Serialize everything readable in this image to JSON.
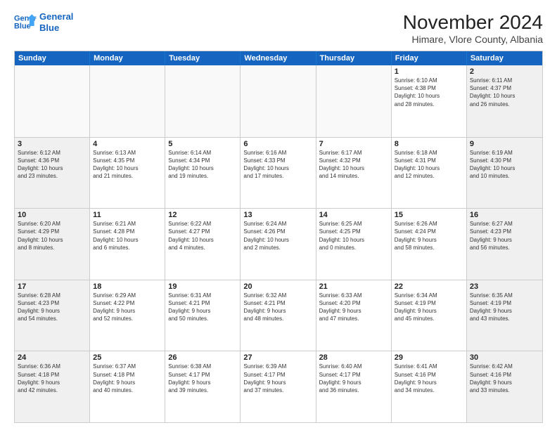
{
  "logo": {
    "line1": "General",
    "line2": "Blue"
  },
  "title": "November 2024",
  "location": "Himare, Vlore County, Albania",
  "header_days": [
    "Sunday",
    "Monday",
    "Tuesday",
    "Wednesday",
    "Thursday",
    "Friday",
    "Saturday"
  ],
  "weeks": [
    [
      {
        "day": "",
        "info": ""
      },
      {
        "day": "",
        "info": ""
      },
      {
        "day": "",
        "info": ""
      },
      {
        "day": "",
        "info": ""
      },
      {
        "day": "",
        "info": ""
      },
      {
        "day": "1",
        "info": "Sunrise: 6:10 AM\nSunset: 4:38 PM\nDaylight: 10 hours\nand 28 minutes."
      },
      {
        "day": "2",
        "info": "Sunrise: 6:11 AM\nSunset: 4:37 PM\nDaylight: 10 hours\nand 26 minutes."
      }
    ],
    [
      {
        "day": "3",
        "info": "Sunrise: 6:12 AM\nSunset: 4:36 PM\nDaylight: 10 hours\nand 23 minutes."
      },
      {
        "day": "4",
        "info": "Sunrise: 6:13 AM\nSunset: 4:35 PM\nDaylight: 10 hours\nand 21 minutes."
      },
      {
        "day": "5",
        "info": "Sunrise: 6:14 AM\nSunset: 4:34 PM\nDaylight: 10 hours\nand 19 minutes."
      },
      {
        "day": "6",
        "info": "Sunrise: 6:16 AM\nSunset: 4:33 PM\nDaylight: 10 hours\nand 17 minutes."
      },
      {
        "day": "7",
        "info": "Sunrise: 6:17 AM\nSunset: 4:32 PM\nDaylight: 10 hours\nand 14 minutes."
      },
      {
        "day": "8",
        "info": "Sunrise: 6:18 AM\nSunset: 4:31 PM\nDaylight: 10 hours\nand 12 minutes."
      },
      {
        "day": "9",
        "info": "Sunrise: 6:19 AM\nSunset: 4:30 PM\nDaylight: 10 hours\nand 10 minutes."
      }
    ],
    [
      {
        "day": "10",
        "info": "Sunrise: 6:20 AM\nSunset: 4:29 PM\nDaylight: 10 hours\nand 8 minutes."
      },
      {
        "day": "11",
        "info": "Sunrise: 6:21 AM\nSunset: 4:28 PM\nDaylight: 10 hours\nand 6 minutes."
      },
      {
        "day": "12",
        "info": "Sunrise: 6:22 AM\nSunset: 4:27 PM\nDaylight: 10 hours\nand 4 minutes."
      },
      {
        "day": "13",
        "info": "Sunrise: 6:24 AM\nSunset: 4:26 PM\nDaylight: 10 hours\nand 2 minutes."
      },
      {
        "day": "14",
        "info": "Sunrise: 6:25 AM\nSunset: 4:25 PM\nDaylight: 10 hours\nand 0 minutes."
      },
      {
        "day": "15",
        "info": "Sunrise: 6:26 AM\nSunset: 4:24 PM\nDaylight: 9 hours\nand 58 minutes."
      },
      {
        "day": "16",
        "info": "Sunrise: 6:27 AM\nSunset: 4:23 PM\nDaylight: 9 hours\nand 56 minutes."
      }
    ],
    [
      {
        "day": "17",
        "info": "Sunrise: 6:28 AM\nSunset: 4:23 PM\nDaylight: 9 hours\nand 54 minutes."
      },
      {
        "day": "18",
        "info": "Sunrise: 6:29 AM\nSunset: 4:22 PM\nDaylight: 9 hours\nand 52 minutes."
      },
      {
        "day": "19",
        "info": "Sunrise: 6:31 AM\nSunset: 4:21 PM\nDaylight: 9 hours\nand 50 minutes."
      },
      {
        "day": "20",
        "info": "Sunrise: 6:32 AM\nSunset: 4:21 PM\nDaylight: 9 hours\nand 48 minutes."
      },
      {
        "day": "21",
        "info": "Sunrise: 6:33 AM\nSunset: 4:20 PM\nDaylight: 9 hours\nand 47 minutes."
      },
      {
        "day": "22",
        "info": "Sunrise: 6:34 AM\nSunset: 4:19 PM\nDaylight: 9 hours\nand 45 minutes."
      },
      {
        "day": "23",
        "info": "Sunrise: 6:35 AM\nSunset: 4:19 PM\nDaylight: 9 hours\nand 43 minutes."
      }
    ],
    [
      {
        "day": "24",
        "info": "Sunrise: 6:36 AM\nSunset: 4:18 PM\nDaylight: 9 hours\nand 42 minutes."
      },
      {
        "day": "25",
        "info": "Sunrise: 6:37 AM\nSunset: 4:18 PM\nDaylight: 9 hours\nand 40 minutes."
      },
      {
        "day": "26",
        "info": "Sunrise: 6:38 AM\nSunset: 4:17 PM\nDaylight: 9 hours\nand 39 minutes."
      },
      {
        "day": "27",
        "info": "Sunrise: 6:39 AM\nSunset: 4:17 PM\nDaylight: 9 hours\nand 37 minutes."
      },
      {
        "day": "28",
        "info": "Sunrise: 6:40 AM\nSunset: 4:17 PM\nDaylight: 9 hours\nand 36 minutes."
      },
      {
        "day": "29",
        "info": "Sunrise: 6:41 AM\nSunset: 4:16 PM\nDaylight: 9 hours\nand 34 minutes."
      },
      {
        "day": "30",
        "info": "Sunrise: 6:42 AM\nSunset: 4:16 PM\nDaylight: 9 hours\nand 33 minutes."
      }
    ]
  ]
}
